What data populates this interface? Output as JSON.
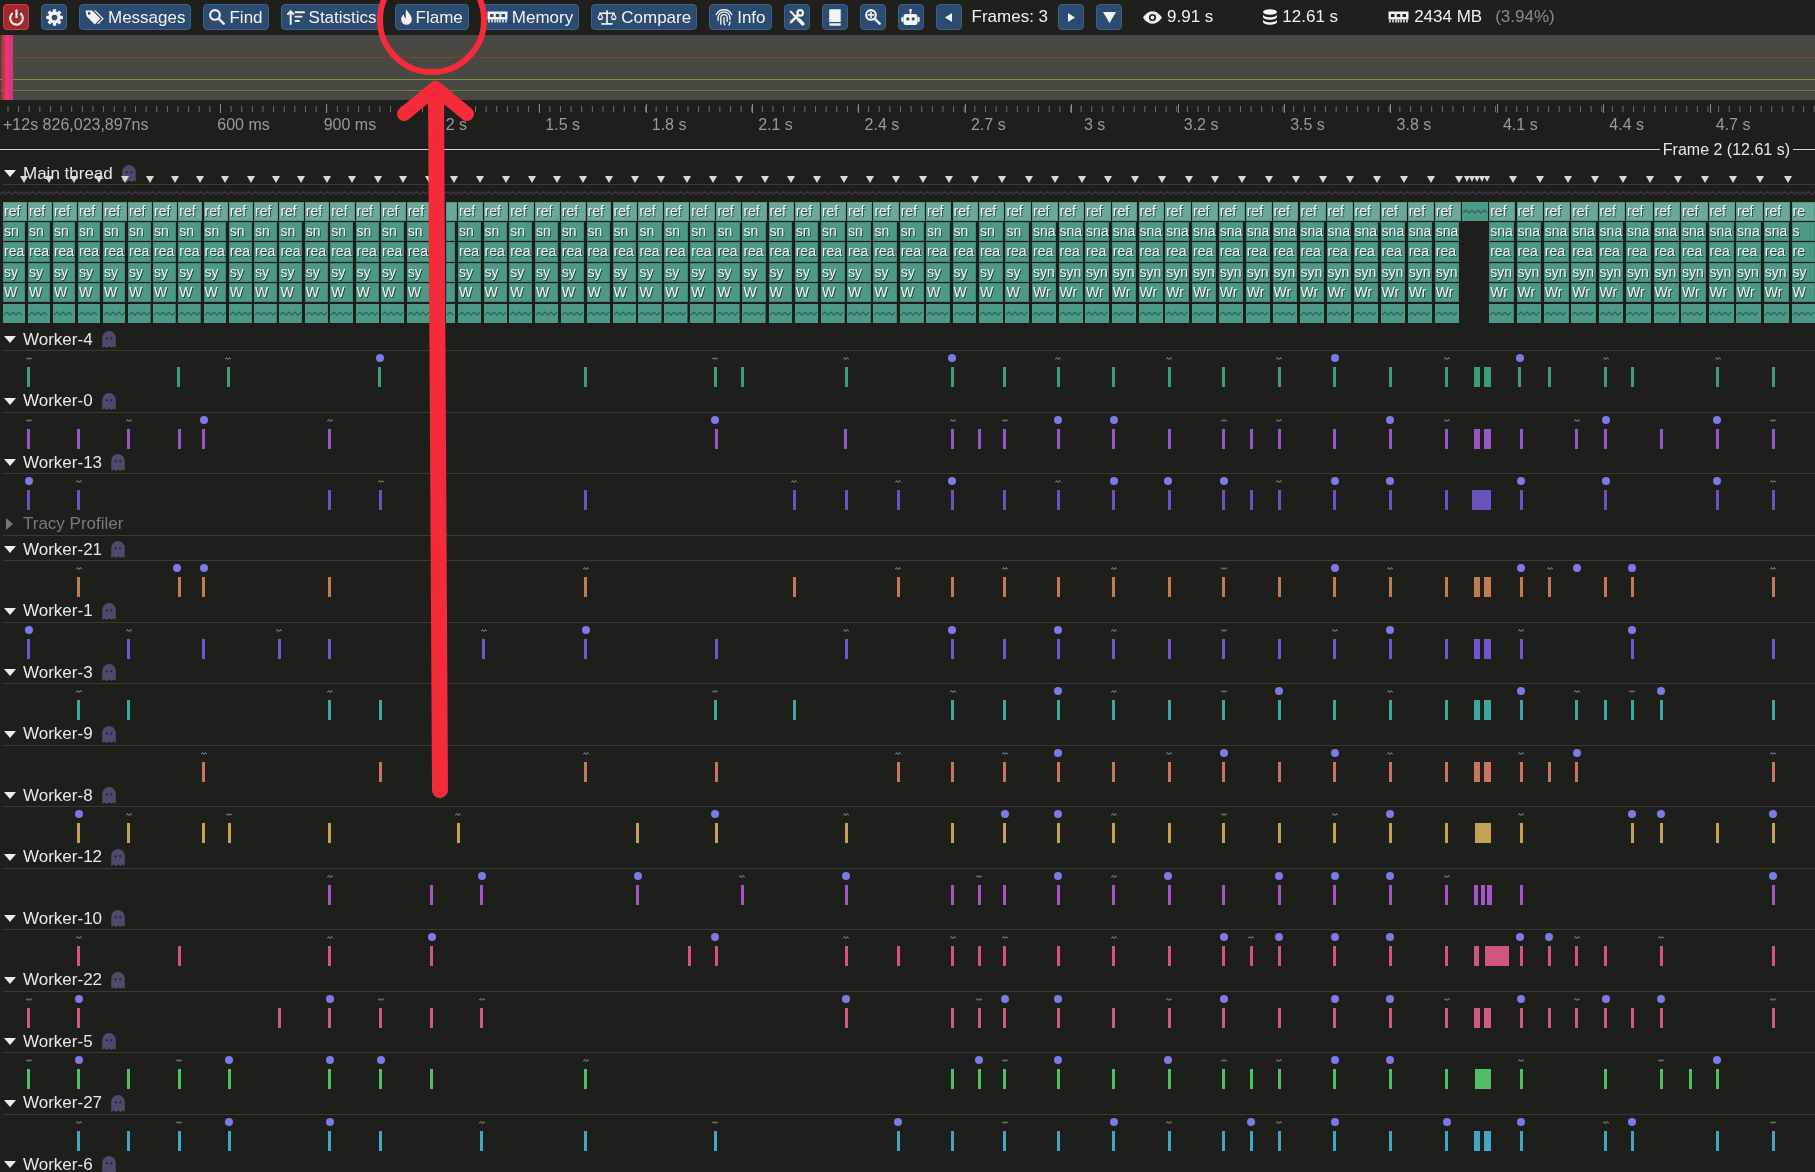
{
  "toolbar": {
    "buttons": [
      "Messages",
      "Find",
      "Statistics",
      "Flame",
      "Memory",
      "Compare",
      "Info"
    ],
    "frames": "Frames: 3",
    "stats": [
      {
        "value": "9.91 s"
      },
      {
        "value": "12.61 s"
      },
      {
        "value": "2434 MB",
        "share": "(3.94%)"
      }
    ]
  },
  "timeline": {
    "start": "+12s 826,023,897ns",
    "ticks": [
      "600 ms",
      "900 ms",
      "2 s",
      "1.5 s",
      "1.8 s",
      "2.1 s",
      "2.4 s",
      "2.7 s",
      "3 s",
      "3.2 s",
      "3.5 s",
      "3.8 s",
      "4.1 s",
      "4.4 s",
      "4.7 s"
    ],
    "frame_label": "Frame 2 (12.61 s)"
  },
  "threads": [
    {
      "name": "Main thread",
      "kind": "main",
      "expanded": true,
      "dimmed": false,
      "color": "#4d9987",
      "zones": [
        {
          "kind": "stack",
          "labels": [
            "ref",
            "sn",
            "rea",
            "sy",
            "W"
          ]
        },
        {
          "kind": "stack",
          "labels": [
            "ref",
            "sn",
            "rea",
            "sy",
            "W"
          ]
        },
        {
          "kind": "stack",
          "labels": [
            "ref",
            "sn",
            "rea",
            "sy",
            "W"
          ]
        },
        {
          "kind": "stack",
          "labels": [
            "ref",
            "sn",
            "rea",
            "sy",
            "W"
          ]
        },
        {
          "kind": "stack",
          "labels": [
            "ref",
            "sn",
            "rea",
            "sy",
            "W"
          ]
        },
        {
          "kind": "stack",
          "labels": [
            "ref",
            "sn",
            "rea",
            "sy",
            "W"
          ]
        },
        {
          "kind": "stack",
          "labels": [
            "ref",
            "sn",
            "rea",
            "sy",
            "W"
          ]
        },
        {
          "kind": "stack",
          "labels": [
            "ref",
            "sn",
            "rea",
            "sy",
            "W"
          ]
        },
        {
          "kind": "stack",
          "labels": [
            "ref",
            "sn",
            "rea",
            "sy",
            "W"
          ]
        },
        {
          "kind": "stack",
          "labels": [
            "ref",
            "sn",
            "rea",
            "sy",
            "W"
          ]
        },
        {
          "kind": "stack",
          "labels": [
            "ref",
            "sn",
            "rea",
            "sy",
            "W"
          ]
        },
        {
          "kind": "stack",
          "labels": [
            "ref",
            "sn",
            "rea",
            "sy",
            "W"
          ]
        },
        {
          "kind": "stack",
          "labels": [
            "ref",
            "sn",
            "rea",
            "sy",
            "W"
          ]
        },
        {
          "kind": "stack",
          "labels": [
            "ref",
            "sn",
            "rea",
            "sy",
            "W"
          ]
        },
        {
          "kind": "stack",
          "labels": [
            "ref",
            "sn",
            "rea",
            "sy",
            "W"
          ]
        },
        {
          "kind": "stack",
          "labels": [
            "ref",
            "sn",
            "rea",
            "sy",
            "W"
          ]
        },
        {
          "kind": "stack",
          "labels": [
            "ref",
            "sn",
            "rea",
            "sy",
            "W"
          ]
        },
        {
          "kind": "covered"
        },
        {
          "kind": "stack",
          "labels": [
            "ref",
            "sn",
            "rea",
            "sy",
            "W"
          ]
        },
        {
          "kind": "stack",
          "labels": [
            "ref",
            "sn",
            "rea",
            "sy",
            "W"
          ]
        },
        {
          "kind": "stack",
          "labels": [
            "ref",
            "sn",
            "rea",
            "sy",
            "W"
          ]
        },
        {
          "kind": "stack",
          "labels": [
            "ref",
            "sn",
            "rea",
            "sy",
            "W"
          ]
        },
        {
          "kind": "stack",
          "labels": [
            "ref",
            "sn",
            "rea",
            "sy",
            "W"
          ]
        },
        {
          "kind": "stack",
          "labels": [
            "ref",
            "sn",
            "rea",
            "sy",
            "W"
          ]
        },
        {
          "kind": "stack",
          "labels": [
            "ref",
            "sn",
            "rea",
            "sy",
            "W"
          ]
        },
        {
          "kind": "stack",
          "labels": [
            "ref",
            "sn",
            "rea",
            "sy",
            "W"
          ]
        },
        {
          "kind": "stack",
          "labels": [
            "ref",
            "sn",
            "rea",
            "sy",
            "W"
          ]
        },
        {
          "kind": "stack",
          "labels": [
            "ref",
            "sn",
            "rea",
            "sy",
            "W"
          ]
        },
        {
          "kind": "stack",
          "labels": [
            "ref",
            "sn",
            "rea",
            "sy",
            "W"
          ]
        },
        {
          "kind": "stack",
          "labels": [
            "ref",
            "sn",
            "rea",
            "sy",
            "W"
          ]
        },
        {
          "kind": "stack",
          "labels": [
            "ref",
            "sn",
            "rea",
            "sy",
            "W"
          ]
        },
        {
          "kind": "stack",
          "labels": [
            "ref",
            "sn",
            "rea",
            "sy",
            "W"
          ]
        },
        {
          "kind": "stack",
          "labels": [
            "ref",
            "sn",
            "rea",
            "sy",
            "W"
          ]
        },
        {
          "kind": "stack",
          "labels": [
            "ref",
            "sn",
            "rea",
            "sy",
            "W"
          ]
        },
        {
          "kind": "stack",
          "labels": [
            "ref",
            "sn",
            "rea",
            "sy",
            "W"
          ]
        },
        {
          "kind": "stack",
          "labels": [
            "ref",
            "sn",
            "rea",
            "sy",
            "W"
          ]
        },
        {
          "kind": "stack",
          "labels": [
            "ref",
            "sn",
            "rea",
            "sy",
            "W"
          ]
        },
        {
          "kind": "stack",
          "labels": [
            "ref",
            "sn",
            "rea",
            "sy",
            "W"
          ]
        },
        {
          "kind": "stack",
          "labels": [
            "ref",
            "sn",
            "rea",
            "sy",
            "W"
          ]
        },
        {
          "kind": "stack",
          "labels": [
            "ref",
            "sn",
            "rea",
            "sy",
            "W"
          ]
        },
        {
          "kind": "stack",
          "labels": [
            "ref",
            "sna",
            "rea",
            "syn",
            "Wr"
          ]
        },
        {
          "kind": "stack",
          "labels": [
            "ref",
            "sna",
            "rea",
            "syn",
            "Wr"
          ]
        },
        {
          "kind": "stack",
          "labels": [
            "ref",
            "sna",
            "rea",
            "syn",
            "Wr"
          ]
        },
        {
          "kind": "stack",
          "labels": [
            "ref",
            "sna",
            "rea",
            "syn",
            "Wr"
          ]
        },
        {
          "kind": "stack",
          "labels": [
            "ref",
            "sna",
            "rea",
            "syn",
            "Wr"
          ]
        },
        {
          "kind": "stack",
          "labels": [
            "ref",
            "sna",
            "rea",
            "syn",
            "Wr"
          ]
        },
        {
          "kind": "stack",
          "labels": [
            "ref",
            "sna",
            "rea",
            "syn",
            "Wr"
          ]
        },
        {
          "kind": "stack",
          "labels": [
            "ref",
            "sna",
            "rea",
            "syn",
            "Wr"
          ]
        },
        {
          "kind": "stack",
          "labels": [
            "ref",
            "sna",
            "rea",
            "syn",
            "Wr"
          ]
        },
        {
          "kind": "stack",
          "labels": [
            "ref",
            "sna",
            "rea",
            "syn",
            "Wr"
          ]
        },
        {
          "kind": "stack",
          "labels": [
            "ref",
            "sna",
            "rea",
            "syn",
            "Wr"
          ]
        },
        {
          "kind": "stack",
          "labels": [
            "ref",
            "sna",
            "rea",
            "syn",
            "Wr"
          ]
        },
        {
          "kind": "stack",
          "labels": [
            "ref",
            "sna",
            "rea",
            "syn",
            "Wr"
          ]
        },
        {
          "kind": "stack",
          "labels": [
            "ref",
            "sna",
            "rea",
            "syn",
            "Wr"
          ]
        },
        {
          "kind": "stack",
          "labels": [
            "ref",
            "sna",
            "rea",
            "syn",
            "Wr"
          ]
        },
        {
          "kind": "stack",
          "labels": [
            "ref",
            "sna",
            "rea",
            "syn",
            "Wr"
          ]
        },
        {
          "kind": "collapsed"
        },
        {
          "kind": "stack",
          "labels": [
            "ref",
            "sna",
            "rea",
            "syn",
            "Wr"
          ]
        },
        {
          "kind": "stack",
          "labels": [
            "ref",
            "sna",
            "rea",
            "syn",
            "Wr"
          ]
        },
        {
          "kind": "stack",
          "labels": [
            "ref",
            "sna",
            "rea",
            "syn",
            "Wr"
          ]
        },
        {
          "kind": "stack",
          "labels": [
            "ref",
            "sna",
            "rea",
            "syn",
            "Wr"
          ]
        },
        {
          "kind": "stack",
          "labels": [
            "ref",
            "sna",
            "rea",
            "syn",
            "Wr"
          ]
        },
        {
          "kind": "stack",
          "labels": [
            "ref",
            "sna",
            "rea",
            "syn",
            "Wr"
          ]
        },
        {
          "kind": "stack",
          "labels": [
            "ref",
            "sna",
            "rea",
            "syn",
            "Wr"
          ]
        },
        {
          "kind": "stack",
          "labels": [
            "ref",
            "sna",
            "rea",
            "syn",
            "Wr"
          ]
        },
        {
          "kind": "stack",
          "labels": [
            "ref",
            "sna",
            "rea",
            "syn",
            "Wr"
          ]
        },
        {
          "kind": "stack",
          "labels": [
            "ref",
            "sna",
            "rea",
            "syn",
            "Wr"
          ]
        },
        {
          "kind": "stack",
          "labels": [
            "ref",
            "sna",
            "rea",
            "syn",
            "Wr"
          ]
        },
        {
          "kind": "stack",
          "labels": [
            "re",
            "s",
            "re",
            "sy",
            "W"
          ]
        }
      ]
    },
    {
      "name": "Worker-4",
      "kind": "worker",
      "expanded": true,
      "dimmed": false,
      "color": "#3b9e76"
    },
    {
      "name": "Worker-0",
      "kind": "worker",
      "expanded": true,
      "dimmed": false,
      "color": "#9a55c4"
    },
    {
      "name": "Worker-13",
      "kind": "worker",
      "expanded": true,
      "dimmed": false,
      "color": "#6a52bf"
    },
    {
      "name": "Tracy Profiler",
      "kind": "worker",
      "expanded": false,
      "dimmed": true
    },
    {
      "name": "Worker-21",
      "kind": "worker",
      "expanded": true,
      "dimmed": false,
      "color": "#c27a55"
    },
    {
      "name": "Worker-1",
      "kind": "worker",
      "expanded": true,
      "dimmed": false,
      "color": "#7455d0"
    },
    {
      "name": "Worker-3",
      "kind": "worker",
      "expanded": true,
      "dimmed": false,
      "color": "#3aa9a1"
    },
    {
      "name": "Worker-9",
      "kind": "worker",
      "expanded": true,
      "dimmed": false,
      "color": "#c9745e"
    },
    {
      "name": "Worker-8",
      "kind": "worker",
      "expanded": true,
      "dimmed": false,
      "color": "#c3a257"
    },
    {
      "name": "Worker-12",
      "kind": "worker",
      "expanded": true,
      "dimmed": false,
      "color": "#a555c8"
    },
    {
      "name": "Worker-10",
      "kind": "worker",
      "expanded": true,
      "dimmed": false,
      "color": "#d0577a"
    },
    {
      "name": "Worker-22",
      "kind": "worker",
      "expanded": true,
      "dimmed": false,
      "color": "#cf5a80"
    },
    {
      "name": "Worker-5",
      "kind": "worker",
      "expanded": true,
      "dimmed": false,
      "color": "#52c062"
    },
    {
      "name": "Worker-27",
      "kind": "worker",
      "expanded": true,
      "dimmed": false,
      "color": "#45a3c4"
    },
    {
      "name": "Worker-6",
      "kind": "worker",
      "expanded": true,
      "dimmed": false
    }
  ],
  "annotation": {
    "circle": true,
    "arrow": true
  }
}
